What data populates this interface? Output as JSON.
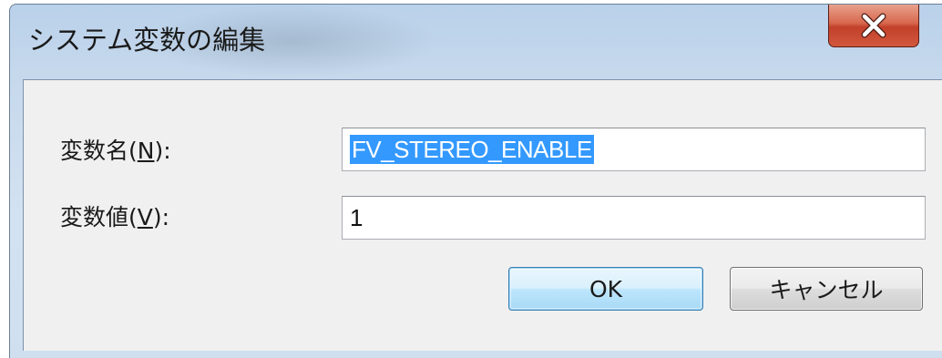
{
  "window": {
    "title": "システム変数の編集",
    "close_label": "X"
  },
  "form": {
    "name_label": "変数名(",
    "name_accel": "N",
    "name_suffix": "):",
    "name_value": "FV_STEREO_ENABLE",
    "value_label": "変数値(",
    "value_accel": "V",
    "value_suffix": "):",
    "value_value": "1"
  },
  "buttons": {
    "ok_label": "OK",
    "cancel_label": "キャンセル"
  },
  "colors": {
    "selection": "#3399ff",
    "close_button": "#c94a32",
    "client_background": "#f0f0f0"
  },
  "icons": {
    "close": "close-icon"
  }
}
